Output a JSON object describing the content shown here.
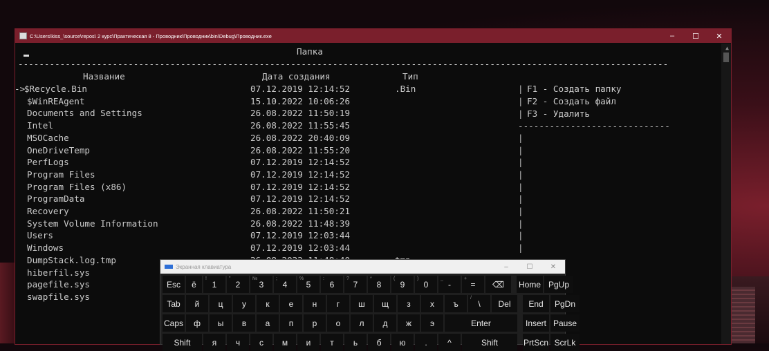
{
  "window": {
    "title": "C:\\Users\\kiss_\\source\\repos\\ 2 курс\\Практическая 8 - Проводник\\Проводник\\bin\\Debug\\Проводник.exe",
    "controls": [
      "–",
      "☐",
      "✕"
    ]
  },
  "console": {
    "header_title": "Папка",
    "separator": "------------------------------------------------------------------------------------------------------------------------------",
    "col_name": "Название",
    "col_date": "Дата создания",
    "col_type": "Тип",
    "selector": "->",
    "rows": [
      {
        "name": "$Recycle.Bin",
        "date": "07.12.2019 12:14:52",
        "type": ".Bin"
      },
      {
        "name": "$WinREAgent",
        "date": "15.10.2022 10:06:26",
        "type": ""
      },
      {
        "name": "Documents and Settings",
        "date": "26.08.2022 11:50:19",
        "type": ""
      },
      {
        "name": "Intel",
        "date": "26.08.2022 11:55:45",
        "type": ""
      },
      {
        "name": "MSOCache",
        "date": "26.08.2022 20:40:09",
        "type": ""
      },
      {
        "name": "OneDriveTemp",
        "date": "26.08.2022 11:55:20",
        "type": ""
      },
      {
        "name": "PerfLogs",
        "date": "07.12.2019 12:14:52",
        "type": ""
      },
      {
        "name": "Program Files",
        "date": "07.12.2019 12:14:52",
        "type": ""
      },
      {
        "name": "Program Files (x86)",
        "date": "07.12.2019 12:14:52",
        "type": ""
      },
      {
        "name": "ProgramData",
        "date": "07.12.2019 12:14:52",
        "type": ""
      },
      {
        "name": "Recovery",
        "date": "26.08.2022 11:50:21",
        "type": ""
      },
      {
        "name": "System Volume Information",
        "date": "26.08.2022 11:48:39",
        "type": ""
      },
      {
        "name": "Users",
        "date": "07.12.2019 12:03:44",
        "type": ""
      },
      {
        "name": "Windows",
        "date": "07.12.2019 12:03:44",
        "type": ""
      },
      {
        "name": "DumpStack.log.tmp",
        "date": "26.08.2022 11:48:40",
        "type": "tmp"
      },
      {
        "name": "hiberfil.sys",
        "date": "",
        "type": ""
      },
      {
        "name": "pagefile.sys",
        "date": "",
        "type": ""
      },
      {
        "name": "swapfile.sys",
        "date": "",
        "type": ""
      }
    ],
    "menu": [
      "F1 - Создать папку",
      "F2 - Создать файл",
      "F3 - Удалить"
    ],
    "menu_separator": "-----------------------------"
  },
  "osk": {
    "title": "Экранная клавиатура",
    "controls": [
      "–",
      "☐",
      "✕"
    ],
    "row1": [
      {
        "label": "Esc"
      },
      {
        "label": "ё"
      },
      {
        "label": "1",
        "sub": "!"
      },
      {
        "label": "2",
        "sub": "\""
      },
      {
        "label": "3",
        "sub": "№"
      },
      {
        "label": "4",
        "sub": ";"
      },
      {
        "label": "5",
        "sub": "%"
      },
      {
        "label": "6",
        "sub": ":"
      },
      {
        "label": "7",
        "sub": "?"
      },
      {
        "label": "8",
        "sub": "*"
      },
      {
        "label": "9",
        "sub": "("
      },
      {
        "label": "0",
        "sub": ")"
      },
      {
        "label": "-",
        "sub": "_"
      },
      {
        "label": "=",
        "sub": "+"
      },
      {
        "label": "⌫"
      },
      {
        "label": "Home"
      },
      {
        "label": "PgUp"
      }
    ],
    "row2": [
      {
        "label": "Tab"
      },
      {
        "label": "й"
      },
      {
        "label": "ц"
      },
      {
        "label": "у"
      },
      {
        "label": "к"
      },
      {
        "label": "е"
      },
      {
        "label": "н"
      },
      {
        "label": "г"
      },
      {
        "label": "ш"
      },
      {
        "label": "щ"
      },
      {
        "label": "з"
      },
      {
        "label": "х"
      },
      {
        "label": "ъ"
      },
      {
        "label": "\\",
        "sub": "/"
      },
      {
        "label": "Del"
      },
      {
        "label": "End"
      },
      {
        "label": "PgDn"
      }
    ],
    "row3": [
      {
        "label": "Caps"
      },
      {
        "label": "ф"
      },
      {
        "label": "ы"
      },
      {
        "label": "в"
      },
      {
        "label": "а"
      },
      {
        "label": "п"
      },
      {
        "label": "р"
      },
      {
        "label": "о"
      },
      {
        "label": "л"
      },
      {
        "label": "д"
      },
      {
        "label": "ж"
      },
      {
        "label": "э"
      },
      {
        "label": "Enter"
      },
      {
        "label": "Insert"
      },
      {
        "label": "Pause"
      }
    ],
    "row4": [
      {
        "label": "Shift"
      },
      {
        "label": "я"
      },
      {
        "label": "ч"
      },
      {
        "label": "с"
      },
      {
        "label": "м"
      },
      {
        "label": "и"
      },
      {
        "label": "т"
      },
      {
        "label": "ь"
      },
      {
        "label": "б"
      },
      {
        "label": "ю"
      },
      {
        "label": "."
      },
      {
        "label": "^"
      },
      {
        "label": "Shift"
      },
      {
        "label": "PrtScn"
      },
      {
        "label": "ScrLk"
      }
    ]
  }
}
